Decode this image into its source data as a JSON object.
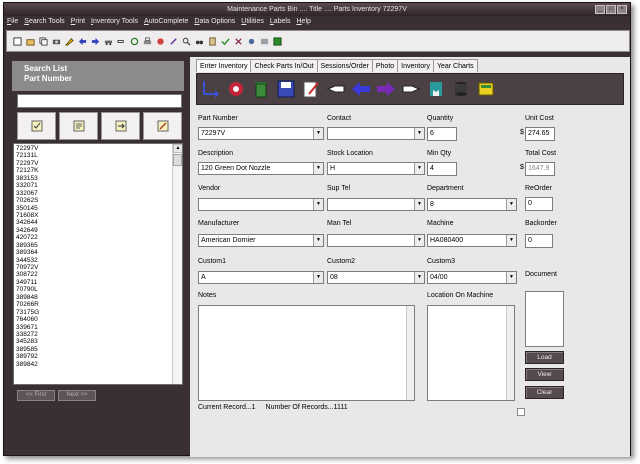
{
  "window": {
    "title": "Maintenance Parts Bin .... Title .... Parts Inventory   72297V"
  },
  "menu": [
    "File",
    "Search Tools",
    "Print",
    "Inventory Tools",
    "AutoComplete",
    "Data Options",
    "Utilities",
    "Labels",
    "Help"
  ],
  "sidebar": {
    "header_line1": "Search List",
    "header_line2": "Part Number",
    "search_value": "",
    "list": [
      "72297V",
      "72131L",
      "72297V",
      "72127K",
      "383153",
      "332071",
      "332067",
      "70262S",
      "350145",
      "71608X",
      "342644",
      "342649",
      "420722",
      "389365",
      "389364",
      "344532",
      "70972V",
      "308722",
      "349711",
      "70790L",
      "389848",
      "70266R",
      "73175G",
      "764060",
      "339671",
      "338272",
      "345283",
      "389585",
      "389792",
      "389842"
    ],
    "first_label": "<< First",
    "next_label": "Next >>"
  },
  "tabs": [
    "Enter Inventory",
    "Check Parts In/Out",
    "Sessions/Order",
    "Photo",
    "Inventory",
    "Year Charts"
  ],
  "form": {
    "part_number_label": "Part Number",
    "part_number": "72297V",
    "contact_label": "Contact",
    "contact": "",
    "quantity_label": "Quantity",
    "quantity": "6",
    "unit_cost_label": "Unit Cost",
    "unit_cost": "274.65",
    "description_label": "Description",
    "description": "120 Green Dot Nozzle",
    "stock_location_label": "Stock Location",
    "stock_location": "H",
    "min_qty_label": "Min Qty",
    "min_qty": "4",
    "total_cost_label": "Total Cost",
    "total_cost": "1647.9",
    "vendor_label": "Vendor",
    "vendor": "",
    "sup_tel_label": "Sup Tel",
    "sup_tel": "",
    "department_label": "Department",
    "department": "8",
    "reorder_label": "ReOrder",
    "reorder": "0",
    "manufacturer_label": "Manufacturer",
    "manufacturer": "American Dornier",
    "man_tel_label": "Man Tel",
    "man_tel": "",
    "machine_label": "Machine",
    "machine": "HA080400",
    "backorder_label": "Backorder",
    "backorder": "0",
    "custom1_label": "Custom1",
    "custom1": "A",
    "custom2_label": "Custom2",
    "custom2": "08",
    "custom3_label": "Custom3",
    "custom3": "04/00",
    "document_label": "Document",
    "notes_label": "Notes",
    "location_label": "Location On Machine",
    "currency_symbol": "$"
  },
  "buttons": {
    "load": "Load",
    "view": "View",
    "clear": "Clear"
  },
  "status": {
    "current_record": "Current Record...1",
    "num_records": "Number Of Records...1111"
  },
  "colors": {
    "frame": "#3a3033",
    "panel": "#e9e8e8",
    "sidebar_header": "#8c8a8a",
    "tab_toolbar": "#4b4044"
  }
}
